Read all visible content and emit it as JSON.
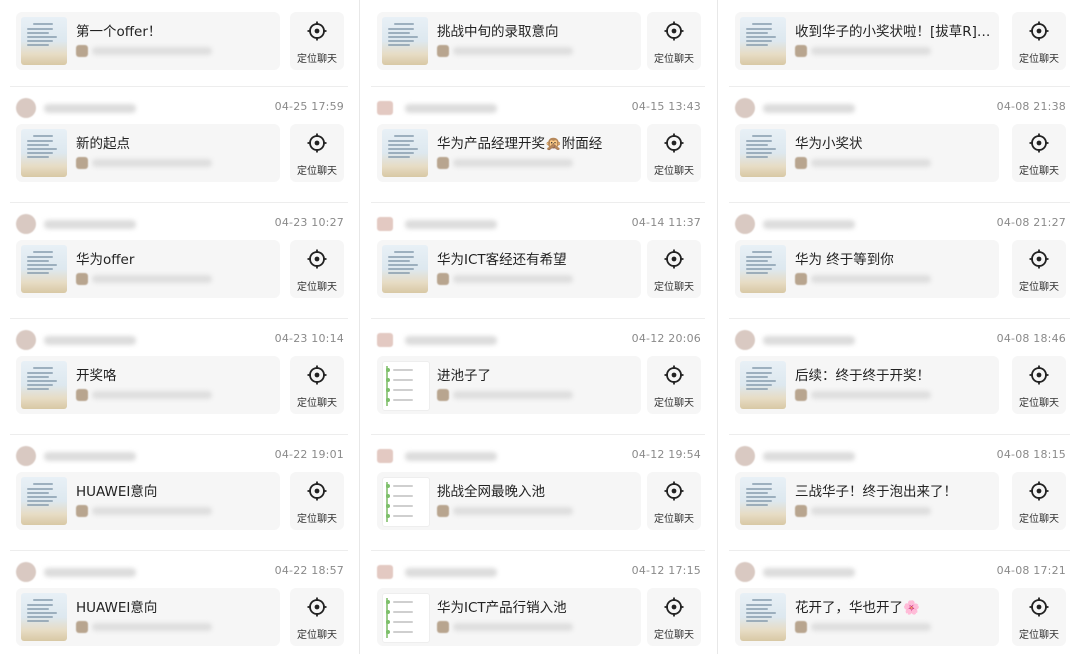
{
  "locate_label": "定位聊天",
  "columns": [
    {
      "entries": [
        {
          "time": "",
          "title": "第一个offer！",
          "thumb": "doc"
        },
        {
          "time": "04-25 17:59",
          "title": "新的起点",
          "thumb": "doc"
        },
        {
          "time": "04-23 10:27",
          "title": "华为offer",
          "thumb": "doc"
        },
        {
          "time": "04-23 10:14",
          "title": "开奖咯",
          "thumb": "doc"
        },
        {
          "time": "04-22 19:01",
          "title": "HUAWEI意向",
          "thumb": "doc"
        },
        {
          "time": "04-22 18:57",
          "title": "HUAWEI意向",
          "thumb": "doc"
        }
      ]
    },
    {
      "entries": [
        {
          "time": "",
          "title": "挑战中旬的录取意向",
          "thumb": "doc"
        },
        {
          "time": "04-15 13:43",
          "title": "华为产品经理开奖🙊附面经",
          "thumb": "doc"
        },
        {
          "time": "04-14 11:37",
          "title": "华为ICT客经还有希望",
          "thumb": "doc"
        },
        {
          "time": "04-12 20:06",
          "title": "进池子了",
          "thumb": "list"
        },
        {
          "time": "04-12 19:54",
          "title": "挑战全网最晚入池",
          "thumb": "list"
        },
        {
          "time": "04-12 17:15",
          "title": "华为ICT产品行销入池",
          "thumb": "list"
        }
      ]
    },
    {
      "entries": [
        {
          "time": "",
          "title": "收到华子的小奖状啦！[拔草R]…",
          "thumb": "doc"
        },
        {
          "time": "04-08 21:38",
          "title": "华为小奖状",
          "thumb": "doc"
        },
        {
          "time": "04-08 21:27",
          "title": "华为 终于等到你",
          "thumb": "doc"
        },
        {
          "time": "04-08 18:46",
          "title": "后续：终于终于开奖！",
          "thumb": "doc"
        },
        {
          "time": "04-08 18:15",
          "title": "三战华子！终于泡出来了！",
          "thumb": "doc"
        },
        {
          "time": "04-08 17:21",
          "title": "花开了，华也开了🌸",
          "thumb": "doc"
        }
      ]
    }
  ]
}
